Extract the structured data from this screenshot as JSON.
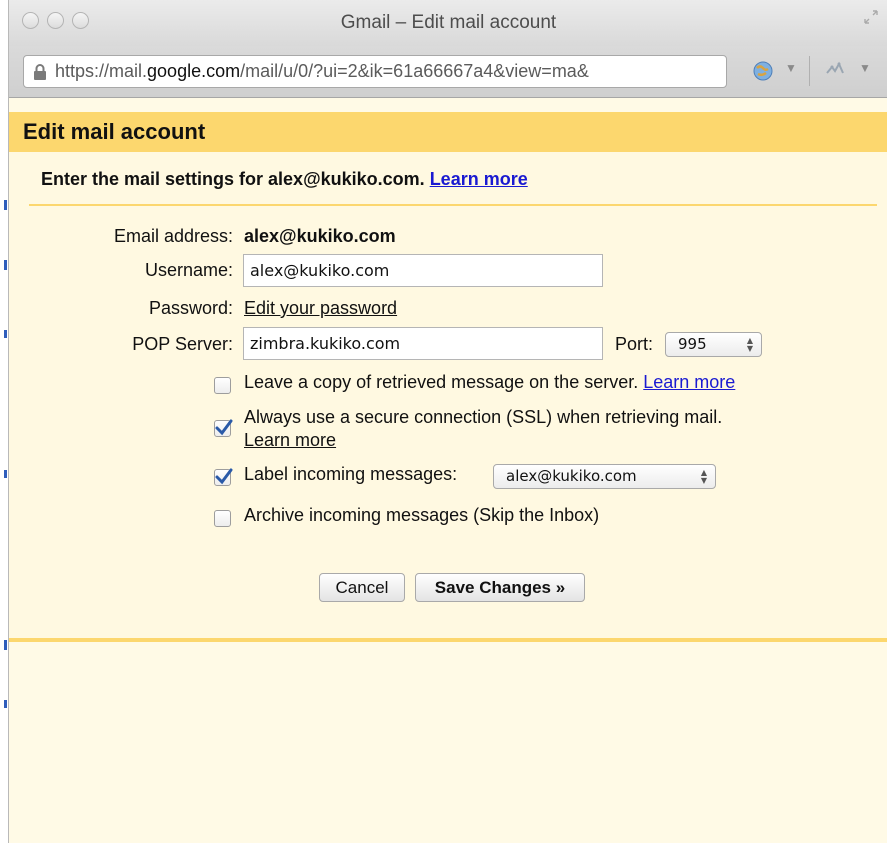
{
  "window": {
    "title": "Gmail – Edit mail account",
    "url_prefix": "https://mail.",
    "url_domain": "google.com",
    "url_suffix": "/mail/u/0/?ui=2&ik=61a66667a4&view=ma&"
  },
  "header": {
    "title": "Edit mail account"
  },
  "intro": {
    "text": "Enter the mail settings for alex@kukiko.com.",
    "learn_more": "Learn more"
  },
  "form": {
    "email_label": "Email address:",
    "email_value": "alex@kukiko.com",
    "username_label": "Username:",
    "username_value": "alex@kukiko.com",
    "password_label": "Password:",
    "password_link": "Edit your password",
    "pop_label": "POP Server:",
    "pop_value": "zimbra.kukiko.com",
    "port_label": "Port:",
    "port_value": "995"
  },
  "options": {
    "leave_copy": {
      "checked": false,
      "text": "Leave a copy of retrieved message on the server.",
      "link": "Learn more"
    },
    "ssl": {
      "checked": true,
      "text": "Always use a secure connection (SSL) when retrieving mail.",
      "link": "Learn more"
    },
    "label": {
      "checked": true,
      "text": "Label incoming messages:",
      "select_value": "alex@kukiko.com"
    },
    "archive": {
      "checked": false,
      "text": "Archive incoming messages (Skip the Inbox)"
    }
  },
  "buttons": {
    "cancel": "Cancel",
    "save": "Save Changes »"
  },
  "colors": {
    "header_band": "#fcd76e",
    "panel_bg": "#fff9e1",
    "link": "#1a1ad1"
  }
}
